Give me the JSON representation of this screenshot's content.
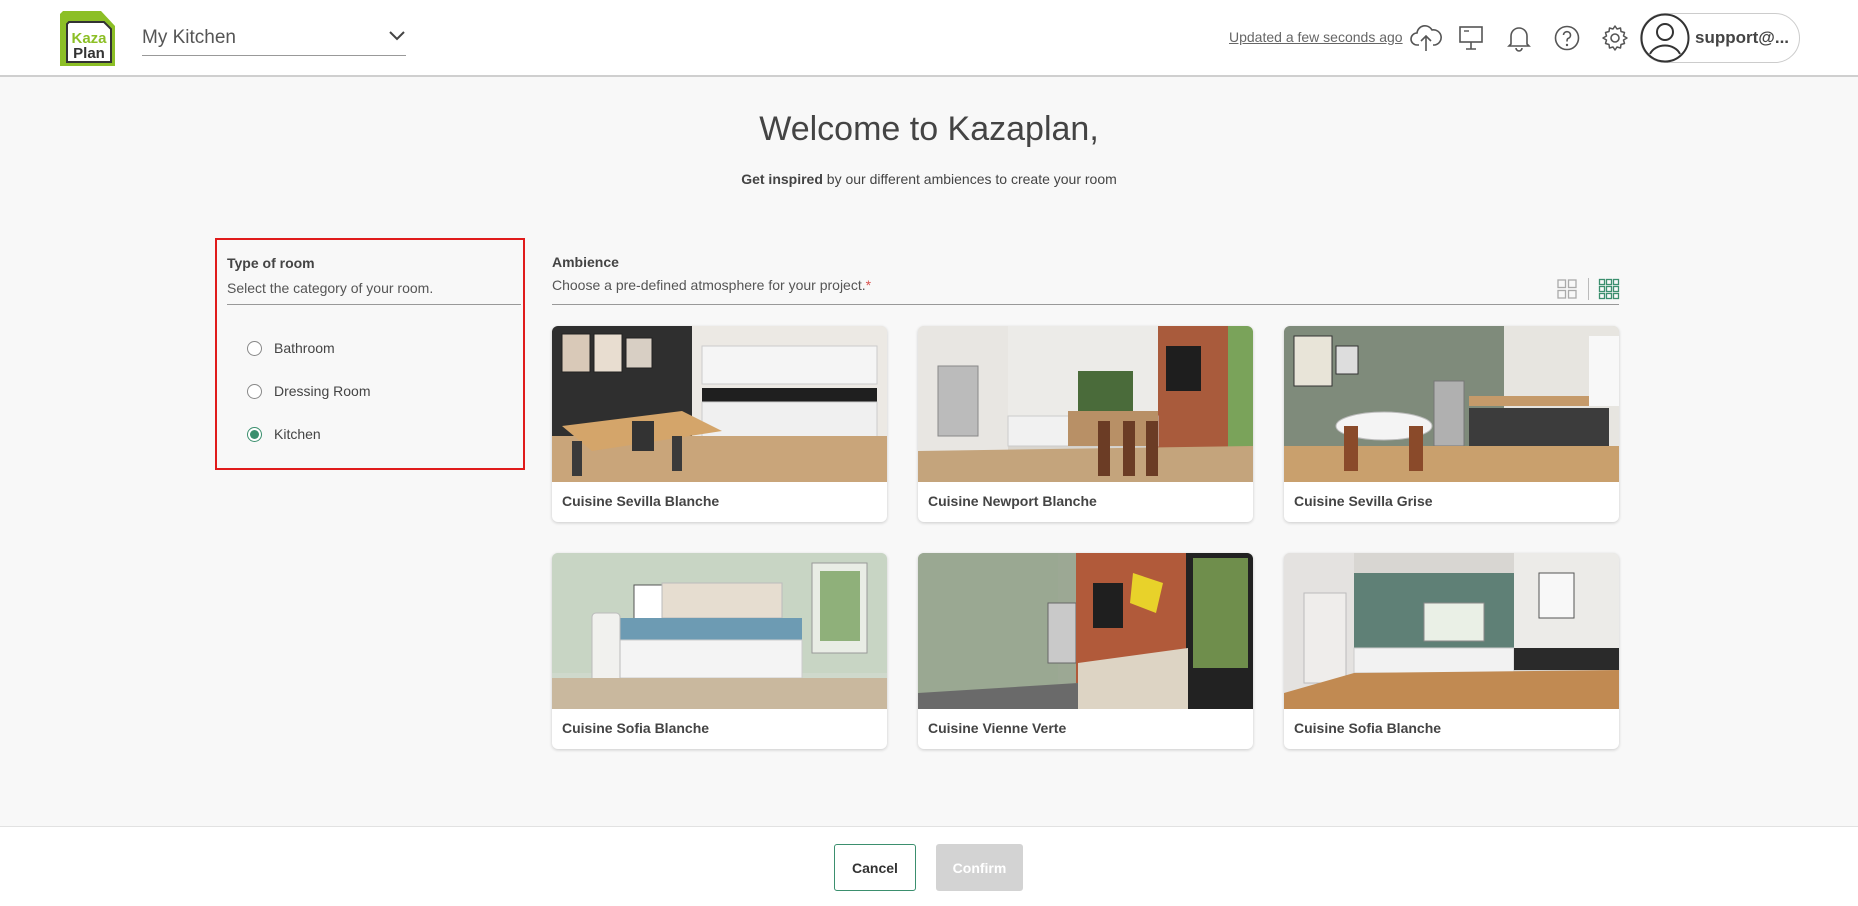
{
  "header": {
    "logo_line1": "Kaza",
    "logo_line2": "Plan",
    "project_name": "My Kitchen",
    "updated_text": "Updated a few seconds ago",
    "user_label": "support@...",
    "icons": [
      "cloud-upload-icon",
      "monitor-icon",
      "bell-icon",
      "help-icon",
      "gear-icon",
      "user-icon",
      "chevron-down-icon"
    ]
  },
  "welcome": {
    "title": "Welcome to Kazaplan,",
    "subtitle_bold": "Get inspired",
    "subtitle_rest": " by our different ambiences to create your room"
  },
  "room_type": {
    "title": "Type of room",
    "description": "Select the category of your room.",
    "options": [
      {
        "label": "Bathroom",
        "checked": false
      },
      {
        "label": "Dressing Room",
        "checked": false
      },
      {
        "label": "Kitchen",
        "checked": true
      }
    ]
  },
  "ambience": {
    "title": "Ambience",
    "description": "Choose a pre-defined atmosphere for your project.",
    "required_mark": "*",
    "view_modes": [
      "grid-large-icon",
      "grid-small-icon"
    ],
    "active_view": "grid-small-icon",
    "cards": [
      {
        "name": "Cuisine Sevilla Blanche"
      },
      {
        "name": "Cuisine Newport Blanche"
      },
      {
        "name": "Cuisine Sevilla Grise"
      },
      {
        "name": "Cuisine Sofia Blanche"
      },
      {
        "name": "Cuisine Vienne Verte"
      },
      {
        "name": "Cuisine Sofia Blanche"
      }
    ]
  },
  "footer": {
    "cancel_label": "Cancel",
    "confirm_label": "Confirm"
  },
  "colors": {
    "accent": "#3b8f6e",
    "logo_green": "#8cbf26",
    "highlight_border": "#e01b1b",
    "confirm_disabled": "#d3d3d3"
  }
}
